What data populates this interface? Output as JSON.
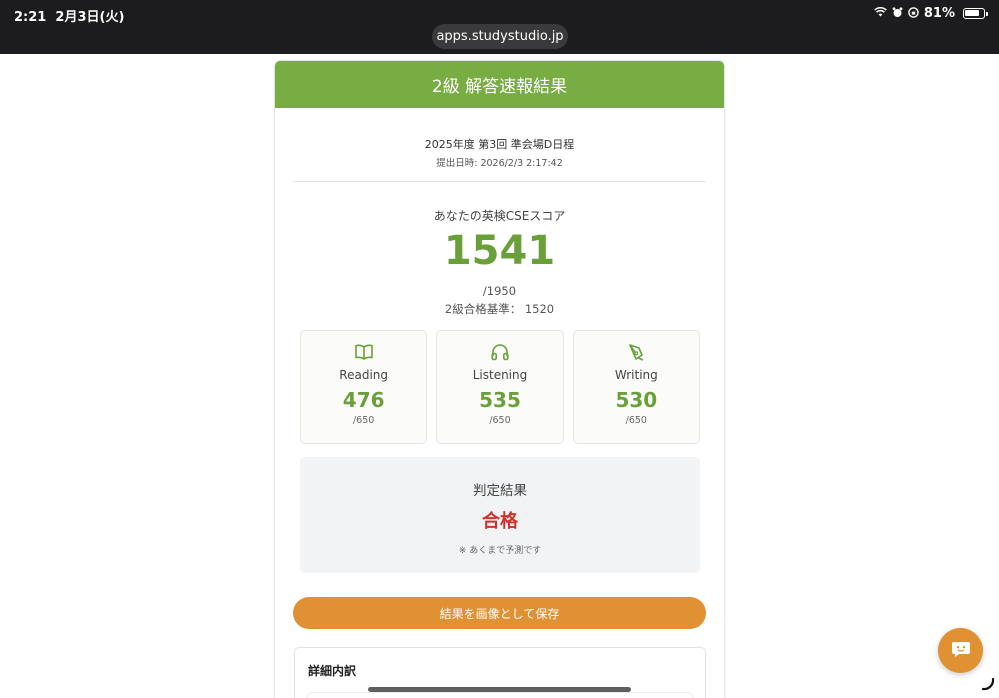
{
  "status_bar": {
    "time": "2:21",
    "date": "2月3日(火)",
    "battery": "81%",
    "url": "apps.studystudio.jp"
  },
  "header": {
    "title": "2級 解答速報結果"
  },
  "meta": {
    "exam": "2025年度 第3回 準会場D日程",
    "submitted": "提出日時: 2026/2/3 2:17:42"
  },
  "score": {
    "label": "あなたの英検CSEスコア",
    "value": "1541",
    "max": "/1950",
    "pass_line": "2級合格基準： 1520"
  },
  "skills": [
    {
      "name": "Reading",
      "score": "476",
      "max": "/650",
      "icon": "book-icon"
    },
    {
      "name": "Listening",
      "score": "535",
      "max": "/650",
      "icon": "headphones-icon"
    },
    {
      "name": "Writing",
      "score": "530",
      "max": "/650",
      "icon": "pen-icon"
    }
  ],
  "judgement": {
    "label": "判定結果",
    "result": "合格",
    "note": "※ あくまで予測です"
  },
  "save_button": "結果を画像として保存",
  "detail": {
    "title": "詳細内訳"
  },
  "colors": {
    "brand_green": "#78ad43",
    "score_green": "#6aa03a",
    "accent_orange": "#e09134",
    "pass_red": "#d0312d"
  }
}
